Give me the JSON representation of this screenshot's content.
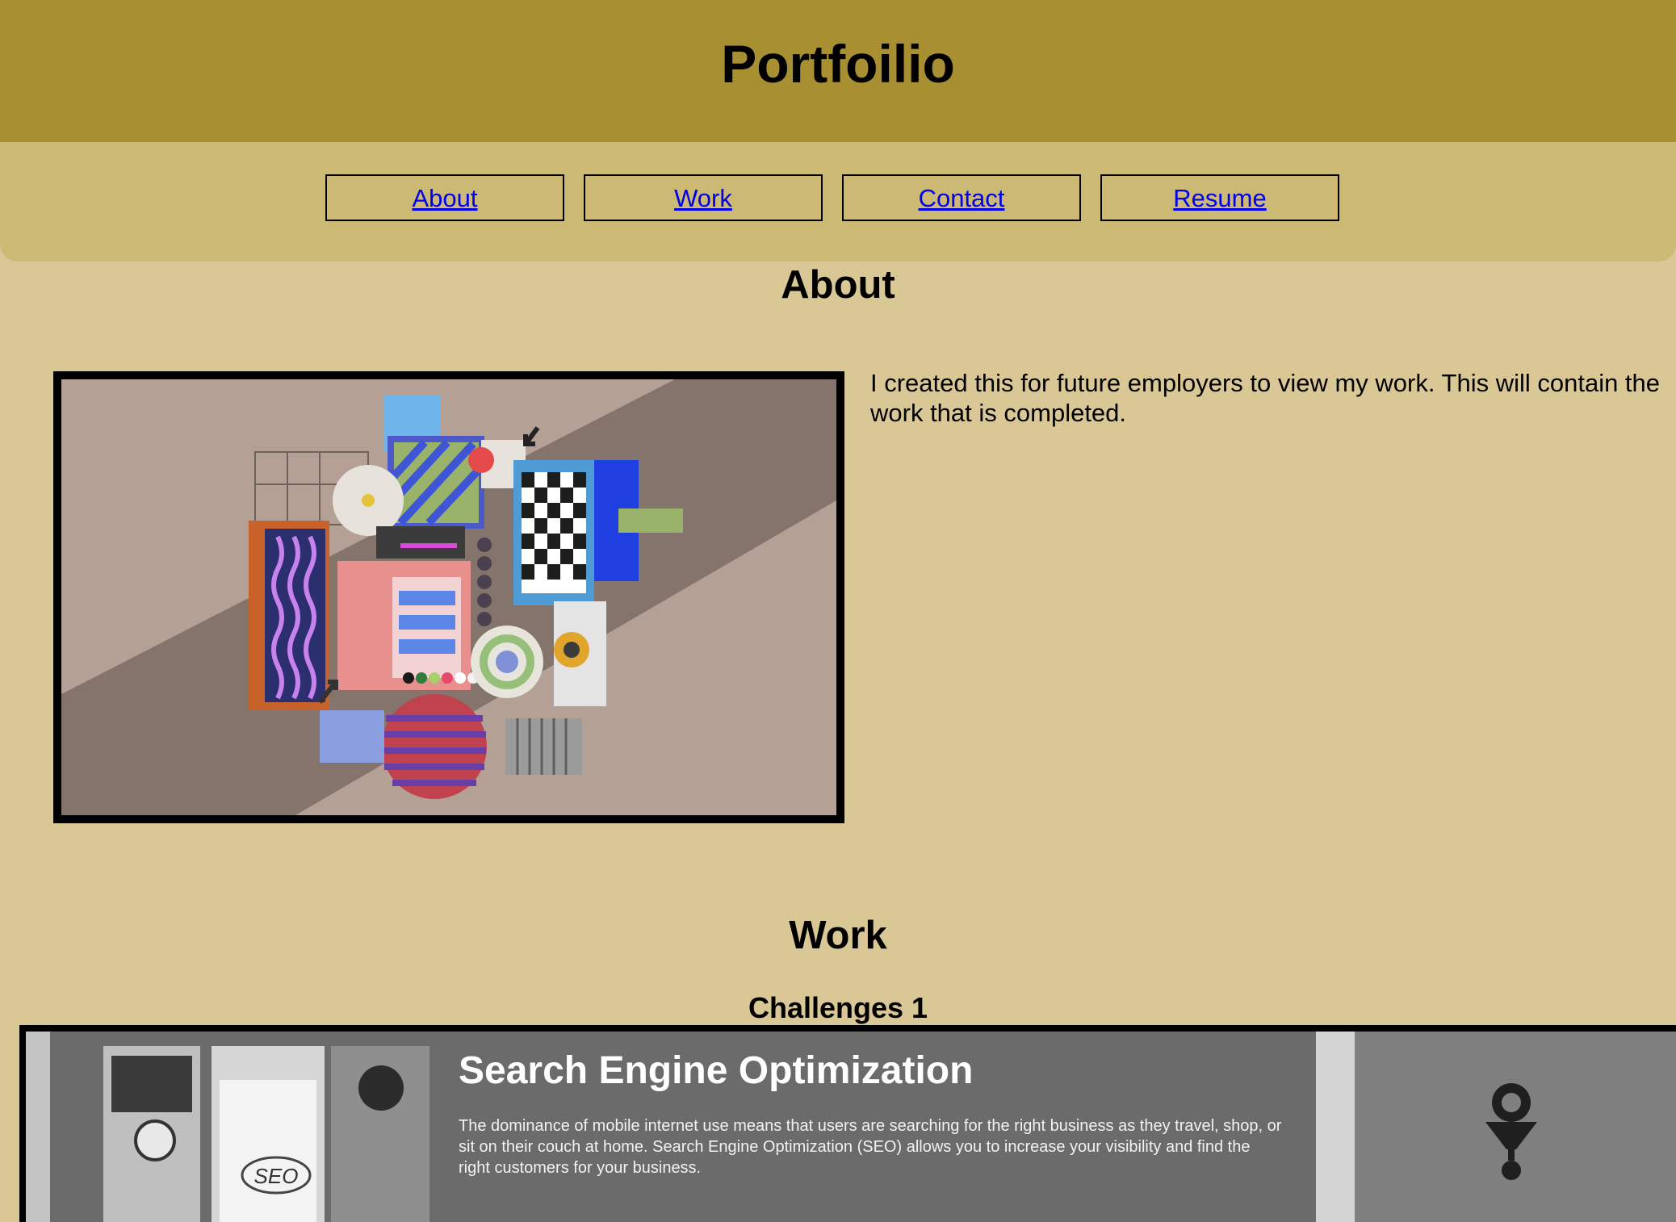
{
  "header": {
    "title": "Portfoilio"
  },
  "nav": {
    "items": [
      {
        "label": "About"
      },
      {
        "label": "Work"
      },
      {
        "label": "Contact"
      },
      {
        "label": "Resume"
      }
    ]
  },
  "about": {
    "title": "About",
    "text": "I created this for future employers to view my work. This will contain the work that is completed."
  },
  "work": {
    "title": "Work",
    "challenge_title": "Challenges 1",
    "preview": {
      "heading": "Search Engine Optimization",
      "body": "The dominance of mobile internet use means that users are searching for the right business as they travel, shop, or sit on their couch at home. Search Engine Optimization (SEO) allows you to increase your visibility and find the right customers for your business.",
      "badge": "SEO"
    }
  },
  "colors": {
    "header_bg": "#a88f31",
    "nav_bg": "#cbb974",
    "page_bg": "#d9c896",
    "link": "#0000ee"
  }
}
